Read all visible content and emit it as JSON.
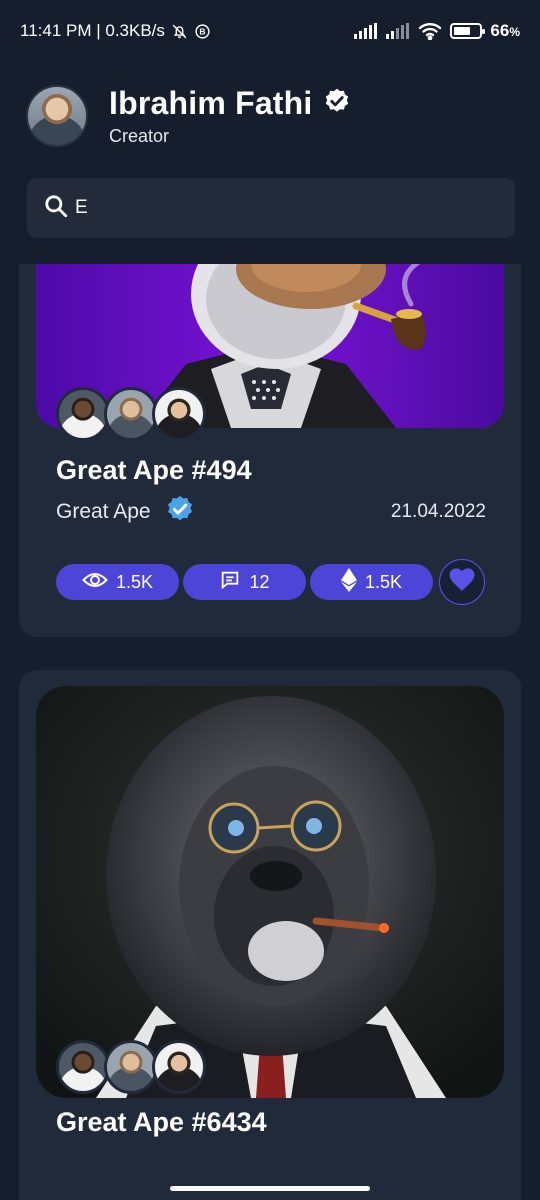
{
  "status_bar": {
    "time_network": "11:41 PM | 0.3KB/s",
    "battery": "66",
    "battery_unit": "%",
    "battery_level": 0.66,
    "icons": [
      "mute-bell-icon",
      "b-badge-icon",
      "signal-icon",
      "signal-weak-icon",
      "wifi-icon",
      "battery-icon"
    ]
  },
  "header": {
    "name": "Ibrahim Fathi",
    "role": "Creator",
    "verified_icon": "verified-badge-icon"
  },
  "search": {
    "value": "E",
    "icon": "search-icon"
  },
  "colors": {
    "background": "#161d2c",
    "card": "#212a3b",
    "accent": "#4d44d8",
    "verified_blue": "#4aa3e6"
  },
  "cards": [
    {
      "title": "Great Ape #494",
      "collection": "Great Ape",
      "date": "21.04.2022",
      "views": "1.5K",
      "comments": "12",
      "price": "1.5K",
      "liked": true
    },
    {
      "title": "Great Ape #6434"
    }
  ]
}
